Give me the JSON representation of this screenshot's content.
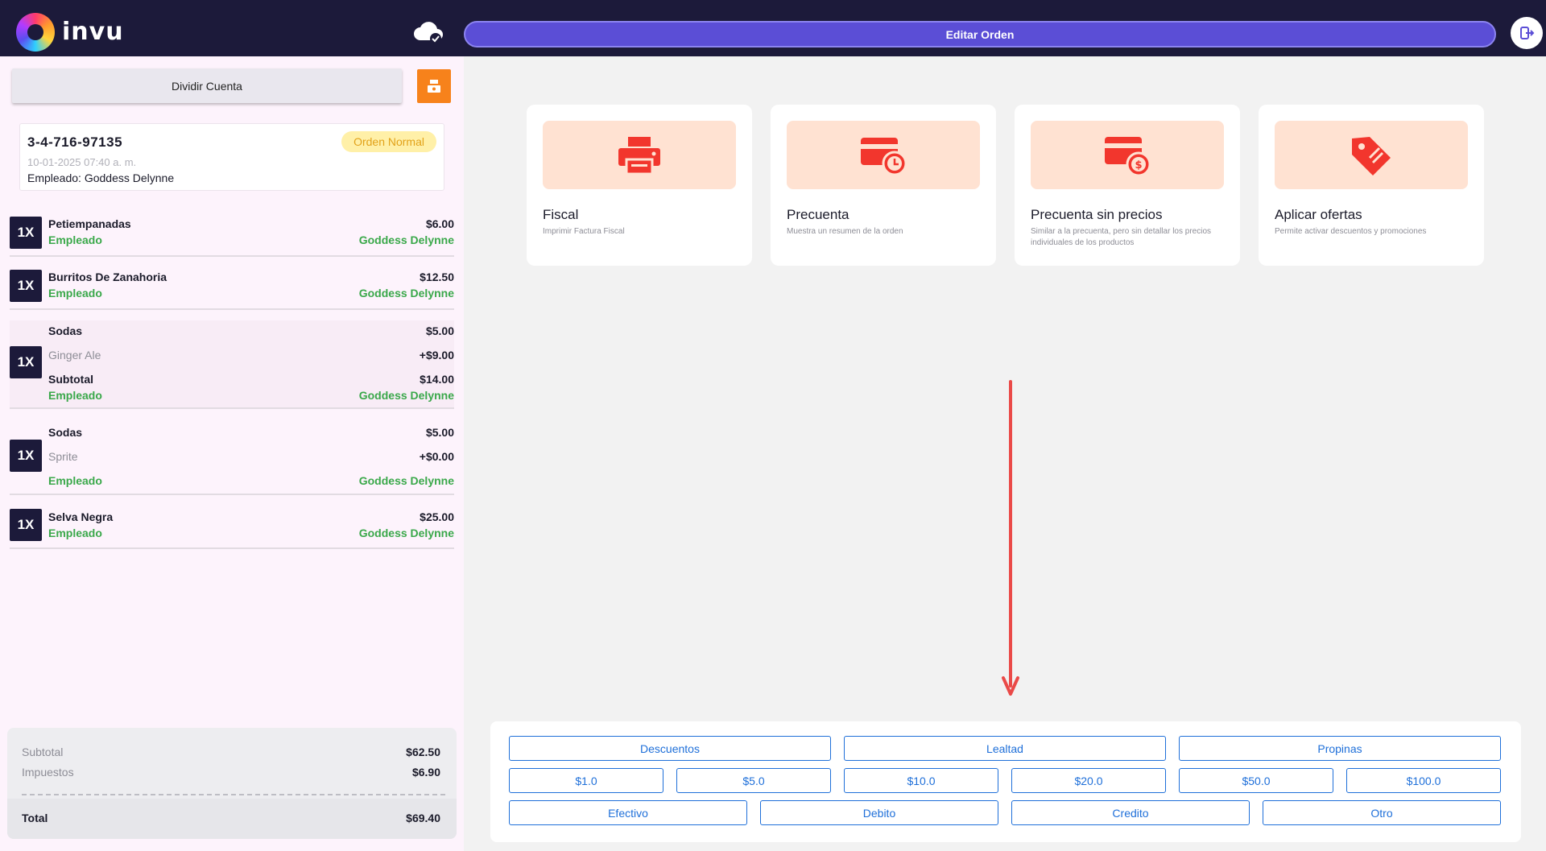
{
  "header": {
    "brand": "invu",
    "edit_order_label": "Editar Orden",
    "colors": {
      "bar": "#1c1a3a",
      "accent": "#5b4ed6"
    }
  },
  "left": {
    "split_label": "Dividir Cuenta",
    "order": {
      "id": "3-4-716-97135",
      "date": "10-01-2025 07:40 a. m.",
      "employee_label": "Empleado:",
      "employee_name": "Goddess Delynne",
      "badge": "Orden Normal"
    },
    "items": [
      {
        "qty": "1X",
        "name": "Petiempanadas",
        "price": "$6.00",
        "emp_label": "Empleado",
        "emp_name": "Goddess Delynne"
      },
      {
        "qty": "1X",
        "name": "Burritos De Zanahoria",
        "price": "$12.50",
        "emp_label": "Empleado",
        "emp_name": "Goddess Delynne"
      },
      {
        "qty": "1X",
        "name": "Sodas",
        "price": "$5.00",
        "mod_name": "Ginger Ale",
        "mod_price": "+$9.00",
        "sub_label": "Subtotal",
        "sub_price": "$14.00",
        "emp_label": "Empleado",
        "emp_name": "Goddess Delynne"
      },
      {
        "qty": "1X",
        "name": "Sodas",
        "price": "$5.00",
        "mod_name": "Sprite",
        "mod_price": "+$0.00",
        "emp_label": "Empleado",
        "emp_name": "Goddess Delynne"
      },
      {
        "qty": "1X",
        "name": "Selva Negra",
        "price": "$25.00",
        "emp_label": "Empleado",
        "emp_name": "Goddess Delynne"
      }
    ],
    "totals": {
      "subtotal_label": "Subtotal",
      "subtotal": "$62.50",
      "tax_label": "Impuestos",
      "tax": "$6.90",
      "total_label": "Total",
      "total": "$69.40"
    }
  },
  "actions": [
    {
      "title": "Fiscal",
      "subtitle": "Imprimir Factura Fiscal",
      "icon": "printer-icon"
    },
    {
      "title": "Precuenta",
      "subtitle": "Muestra un resumen de la orden",
      "icon": "card-clock-icon"
    },
    {
      "title": "Precuenta sin precios",
      "subtitle": "Similar a la precuenta, pero sin detallar los precios individuales de los productos",
      "icon": "card-dollar-icon"
    },
    {
      "title": "Aplicar ofertas",
      "subtitle": "Permite activar descuentos y promociones",
      "icon": "tag-icon"
    }
  ],
  "payment": {
    "row1": [
      "Descuentos",
      "Lealtad",
      "Propinas"
    ],
    "row2": [
      "$1.0",
      "$5.0",
      "$10.0",
      "$20.0",
      "$50.0",
      "$100.0"
    ],
    "row3": [
      "Efectivo",
      "Debito",
      "Credito",
      "Otro"
    ],
    "color": "#1e6fd9"
  }
}
